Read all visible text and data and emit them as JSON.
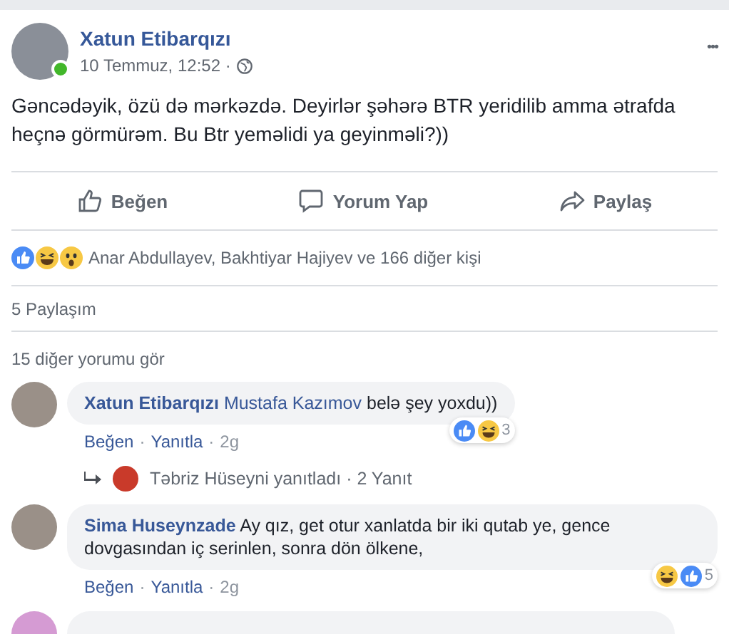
{
  "post": {
    "author": "Xatun Etibarqızı",
    "online": true,
    "date": "10 Temmuz, 12:52 ·",
    "menu": "•••",
    "text": "Gəncədəyik, özü də mərkəzdə. Deyirlər şəhərə BTR yeridilib amma ətrafda heçnə görmürəm. Bu Btr yeməlidi ya geyinməli?))"
  },
  "actions": [
    {
      "kind": "like",
      "label": "Beğen"
    },
    {
      "kind": "comment",
      "label": "Yorum Yap"
    },
    {
      "kind": "share",
      "label": "Paylaş"
    }
  ],
  "reactions": {
    "kinds": [
      {
        "kind": "like"
      },
      {
        "kind": "haha"
      },
      {
        "kind": "wow"
      }
    ],
    "text": "Anar Abdullayev, Bakhtiyar Hajiyev ve 166 diğer kişi"
  },
  "shares": "5 Paylaşım",
  "more_comments": "15 diğer yorumu gör",
  "separator": "·",
  "comments": [
    {
      "author": "Xatun Etibarqızı",
      "mention": "Mustafa Kazımov",
      "text": "belə şey yoxdu))",
      "reactions": [
        {
          "kind": "like"
        },
        {
          "kind": "haha"
        }
      ],
      "reaction_count": "3",
      "actions": [
        "Beğen",
        "Yanıtla"
      ],
      "time": "2g",
      "reply_summary": {
        "text": "Təbriz Hüseyni yanıtladı",
        "count": "2 Yanıt"
      }
    },
    {
      "author": "Sima Huseynzade",
      "text": "Ay qız, get otur xanlatda bir iki qutab ye, gence dovgasından iç serinlen, sonra dön ölkene,",
      "reactions": [
        {
          "kind": "haha"
        },
        {
          "kind": "like"
        }
      ],
      "reaction_count": "5",
      "actions": [
        "Beğen",
        "Yanıtla"
      ],
      "time": "2g"
    }
  ]
}
